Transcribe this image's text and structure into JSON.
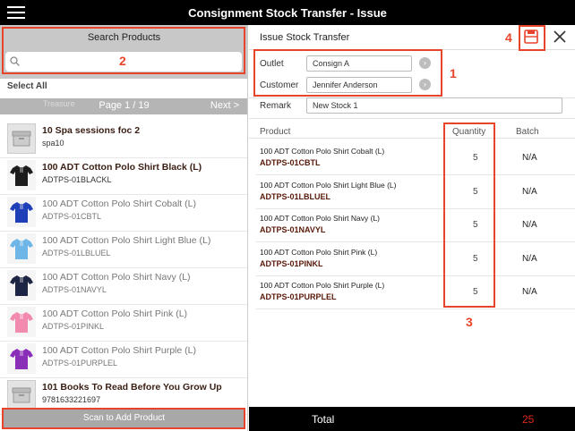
{
  "header": {
    "title": "Consignment Stock Transfer - Issue"
  },
  "left": {
    "search_title": "Search Products",
    "search_placeholder": "",
    "select_all": "Select All",
    "pager_ghost": "Treasure",
    "pager_label": "Page 1 / 19",
    "next_label": "Next >",
    "products": [
      {
        "name": "10 Spa sessions foc 2",
        "code": "spa10",
        "thumb": "box-icon",
        "disabled": false,
        "color": "#bdbdbd"
      },
      {
        "name": "100 ADT Cotton Polo Shirt Black (L)",
        "code": "ADTPS-01BLACKL",
        "thumb": "shirt-icon",
        "disabled": false,
        "color": "#1c1c1c"
      },
      {
        "name": "100 ADT Cotton Polo Shirt Cobalt (L)",
        "code": "ADTPS-01CBTL",
        "thumb": "shirt-icon",
        "disabled": true,
        "color": "#1f3fb8"
      },
      {
        "name": "100 ADT Cotton Polo Shirt Light Blue (L)",
        "code": "ADTPS-01LBLUEL",
        "thumb": "shirt-icon",
        "disabled": true,
        "color": "#6fb6e8"
      },
      {
        "name": "100 ADT Cotton Polo Shirt Navy (L)",
        "code": "ADTPS-01NAVYL",
        "thumb": "shirt-icon",
        "disabled": true,
        "color": "#1c2544"
      },
      {
        "name": "100 ADT Cotton Polo Shirt Pink (L)",
        "code": "ADTPS-01PINKL",
        "thumb": "shirt-icon",
        "disabled": true,
        "color": "#f28ab0"
      },
      {
        "name": "100 ADT Cotton Polo Shirt Purple (L)",
        "code": "ADTPS-01PURPLEL",
        "thumb": "shirt-icon",
        "disabled": true,
        "color": "#8a2fb8"
      },
      {
        "name": "101 Books To Read Before You Grow Up",
        "code": "9781633221697",
        "thumb": "box-icon",
        "disabled": false,
        "color": "#bdbdbd"
      }
    ],
    "scan_label": "Scan to Add Product"
  },
  "right": {
    "title": "Issue Stock Transfer",
    "outlet_label": "Outlet",
    "outlet_value": "Consign A",
    "customer_label": "Customer",
    "customer_value": "Jennifer Anderson",
    "remark_label": "Remark",
    "remark_value": "New Stock 1",
    "col_product": "Product",
    "col_quantity": "Quantity",
    "col_batch": "Batch",
    "rows": [
      {
        "name": "100 ADT Cotton Polo Shirt Cobalt (L)",
        "code": "ADTPS-01CBTL",
        "qty": "5",
        "batch": "N/A"
      },
      {
        "name": "100 ADT Cotton Polo Shirt Light Blue (L)",
        "code": "ADTPS-01LBLUEL",
        "qty": "5",
        "batch": "N/A"
      },
      {
        "name": "100 ADT Cotton Polo Shirt Navy (L)",
        "code": "ADTPS-01NAVYL",
        "qty": "5",
        "batch": "N/A"
      },
      {
        "name": "100 ADT Cotton Polo Shirt Pink (L)",
        "code": "ADTPS-01PINKL",
        "qty": "5",
        "batch": "N/A"
      },
      {
        "name": "100 ADT Cotton Polo Shirt Purple (L)",
        "code": "ADTPS-01PURPLEL",
        "qty": "5",
        "batch": "N/A"
      }
    ]
  },
  "footer": {
    "total_label": "Total",
    "total_value": "25"
  },
  "callouts": {
    "c1": "1",
    "c2": "2",
    "c3": "3",
    "c4": "4"
  },
  "colors": {
    "accent_red": "#e8442c",
    "header_bg": "#000000"
  }
}
